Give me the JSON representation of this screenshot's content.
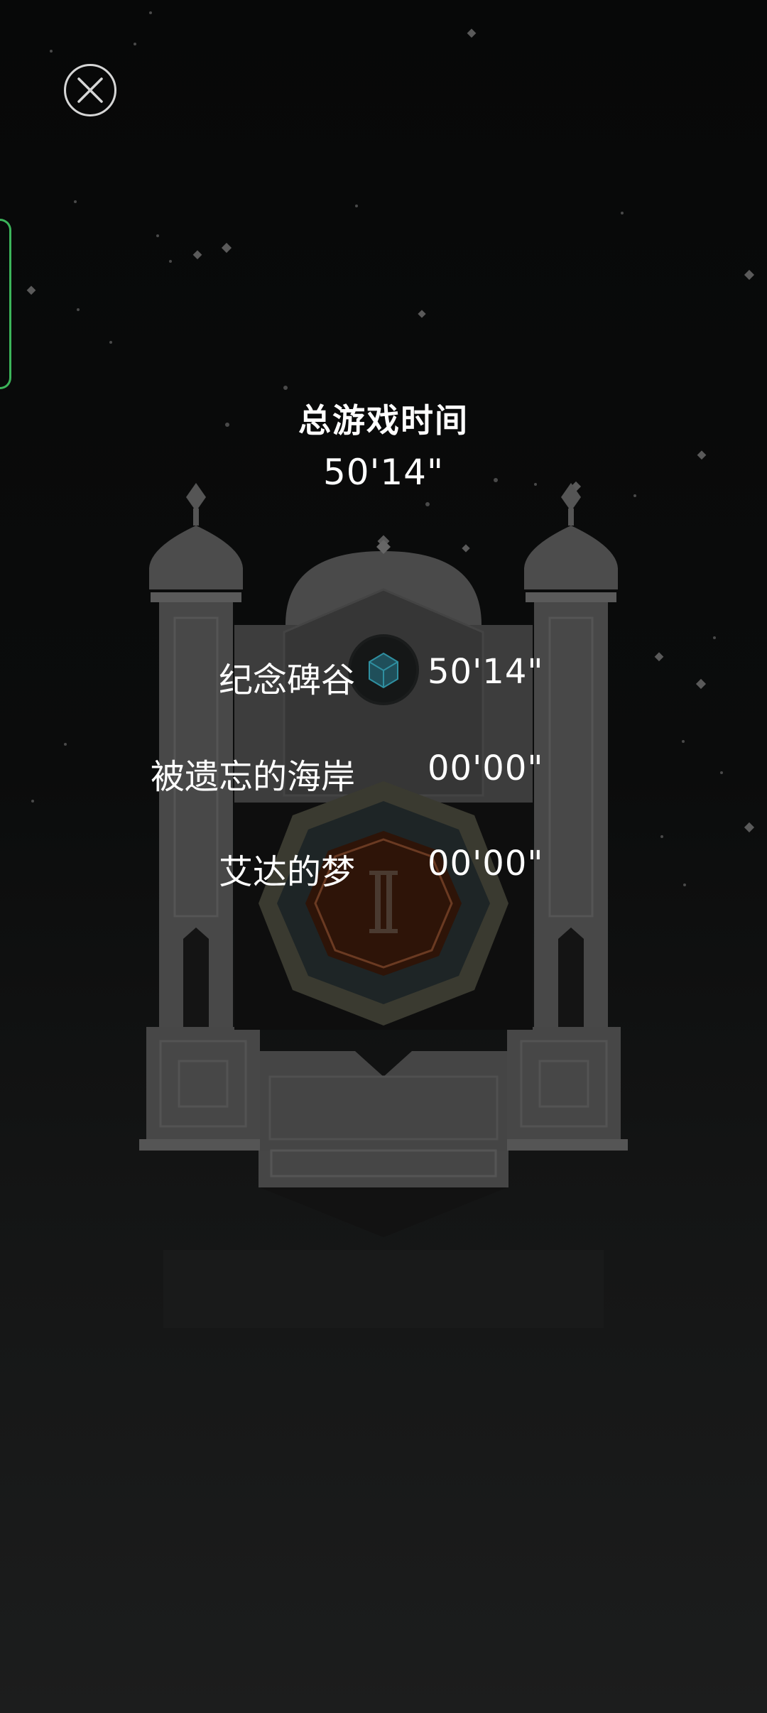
{
  "header": {
    "total_label": "总游戏时间",
    "total_time": "50'14\""
  },
  "chapters": [
    {
      "name": "纪念碑谷",
      "time": "50'14\"",
      "icon": "cube-icon"
    },
    {
      "name": "被遗忘的海岸",
      "time": "00'00\""
    },
    {
      "name": "艾达的梦",
      "time": "00'00\""
    }
  ],
  "icons": {
    "close": "close-icon",
    "chapter_emblem": "cube-icon",
    "roman_numeral": "II"
  },
  "colors": {
    "background": "#0a0b0b",
    "text": "#ffffff",
    "side_tab": "#3cb45a",
    "emblem_glow": "#2f8fa0",
    "core": "#3a1a0c",
    "ring": "#5a5a3c"
  }
}
